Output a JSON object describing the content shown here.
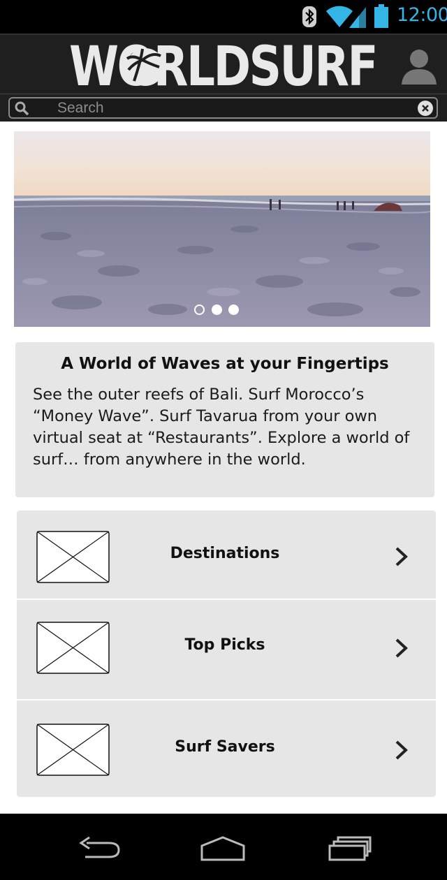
{
  "status_bar": {
    "time": "12:00",
    "icons": [
      "bluetooth-icon",
      "wifi-icon",
      "signal-icon",
      "battery-icon"
    ],
    "accent_color": "#33b5e5"
  },
  "header": {
    "logo_text": "WORLDSURF",
    "profile_icon": "user-icon",
    "background": "#1f1f1f"
  },
  "search": {
    "placeholder": "Search",
    "value": "",
    "icons": [
      "search-icon",
      "clear-icon"
    ]
  },
  "carousel": {
    "slide_count": 3,
    "active_index": 0
  },
  "intro": {
    "title": "A World of Waves at your Fingertips",
    "body": "See the outer reefs of Bali. Surf Morocco’s “Money Wave”. Surf Tavarua from your own virtual seat at “Restaurants”. Explore a world of surf… from anywhere in the world."
  },
  "menu": {
    "items": [
      {
        "label": "Destinations",
        "icon": "image-placeholder-icon"
      },
      {
        "label": "Top Picks",
        "icon": "image-placeholder-icon"
      },
      {
        "label": "Surf Savers",
        "icon": "image-placeholder-icon"
      }
    ],
    "chevron_icon": "chevron-right-icon",
    "background": "#e6e6e6"
  },
  "navbar": {
    "buttons": [
      "back-icon",
      "home-icon",
      "recent-apps-icon"
    ]
  }
}
